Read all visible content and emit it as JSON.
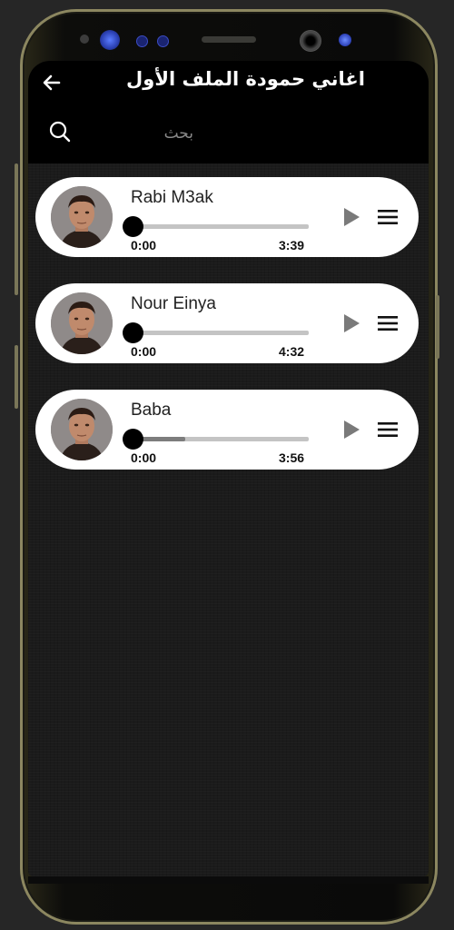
{
  "app": {
    "title": "اغاني حمودة الملف الأول",
    "back_icon": "arrow-left-icon"
  },
  "search": {
    "placeholder": "بحث",
    "value": "",
    "icon": "search-icon"
  },
  "songs": [
    {
      "title": "Rabi M3ak",
      "current_time": "0:00",
      "duration": "3:39",
      "progress_buffered": 0.0
    },
    {
      "title": "Nour Einya",
      "current_time": "0:00",
      "duration": "4:32",
      "progress_buffered": 0.0
    },
    {
      "title": "Baba",
      "current_time": "0:00",
      "duration": "3:56",
      "progress_buffered": 0.29
    }
  ],
  "colors": {
    "appbar": "#000000",
    "background": "#1b1b1b",
    "card": "#ffffff",
    "knob": "#000000",
    "play_icon": "#7a7a7a"
  }
}
